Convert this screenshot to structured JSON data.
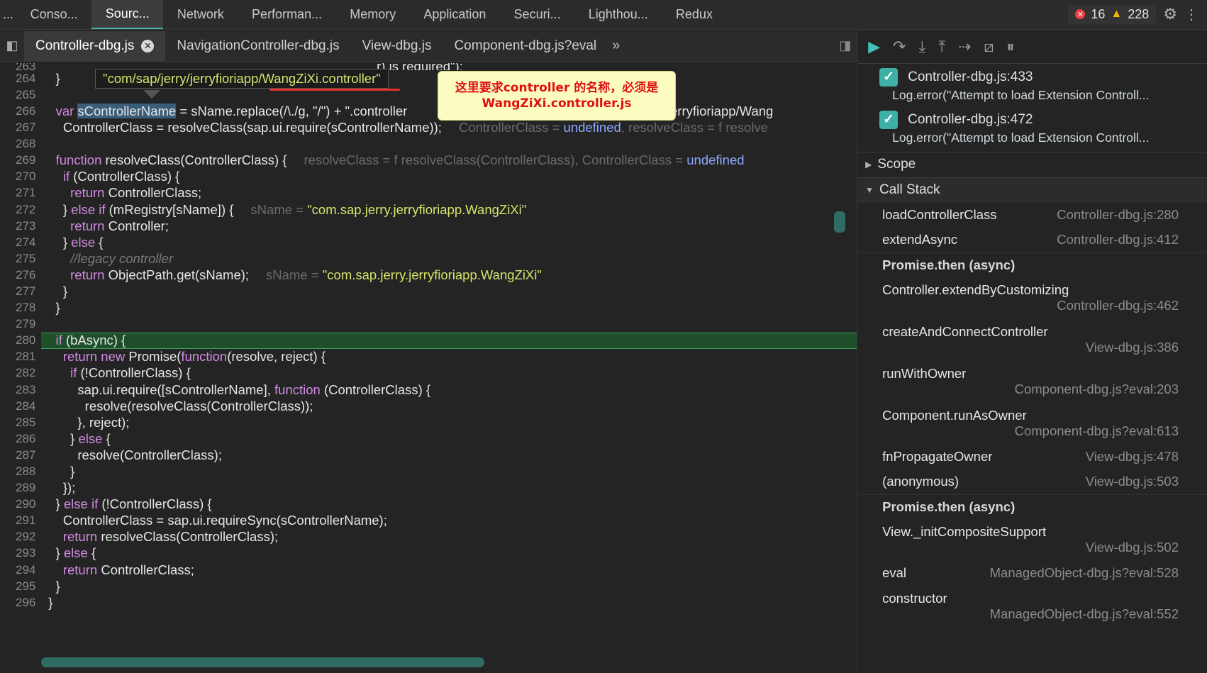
{
  "tabs": [
    "Conso...",
    "Sourc...",
    "Network",
    "Performan...",
    "Memory",
    "Application",
    "Securi...",
    "Lighthou...",
    "Redux"
  ],
  "active_tab": "Sourc...",
  "ellipsis": "...",
  "counts": {
    "errors": "16",
    "warnings": "228"
  },
  "files": {
    "tabs": [
      "Controller-dbg.js",
      "NavigationController-dbg.js",
      "View-dbg.js",
      "Component-dbg.js?eval"
    ],
    "more": "»"
  },
  "editor": {
    "hover_value": "\"com/sap/jerry/jerryfioriapp/WangZiXi.controller\"",
    "callout": {
      "line1": "这里要求controller 的名称，必须是",
      "line2": "WangZiXi.controller.js"
    },
    "partial_top": ".r) is required\");",
    "right_overflow": "erryfioriapp/Wang",
    "lines": [
      {
        "n": "264",
        "t": "    }"
      },
      {
        "n": "265",
        "t": ""
      },
      {
        "n": "266",
        "t": ""
      },
      {
        "n": "267",
        "t": ""
      },
      {
        "n": "268",
        "t": ""
      },
      {
        "n": "269",
        "t": ""
      },
      {
        "n": "270",
        "t": ""
      },
      {
        "n": "271",
        "t": ""
      },
      {
        "n": "272",
        "t": ""
      },
      {
        "n": "273",
        "t": ""
      },
      {
        "n": "274",
        "t": ""
      },
      {
        "n": "275",
        "t": ""
      },
      {
        "n": "276",
        "t": ""
      },
      {
        "n": "277",
        "t": "      }"
      },
      {
        "n": "278",
        "t": "    }"
      },
      {
        "n": "279",
        "t": ""
      },
      {
        "n": "280",
        "t": ""
      },
      {
        "n": "281",
        "t": ""
      },
      {
        "n": "282",
        "t": ""
      },
      {
        "n": "283",
        "t": ""
      },
      {
        "n": "284",
        "t": ""
      },
      {
        "n": "285",
        "t": "          }, reject);"
      },
      {
        "n": "286",
        "t": ""
      },
      {
        "n": "287",
        "t": "          resolve(ControllerClass);"
      },
      {
        "n": "288",
        "t": "        }"
      },
      {
        "n": "289",
        "t": "      });"
      },
      {
        "n": "290",
        "t": ""
      },
      {
        "n": "291",
        "t": "      ControllerClass = sap.ui.requireSync(sControllerName);"
      },
      {
        "n": "292",
        "t": ""
      },
      {
        "n": "293",
        "t": ""
      },
      {
        "n": "294",
        "t": ""
      },
      {
        "n": "295",
        "t": "    }"
      },
      {
        "n": "296",
        "t": "  }"
      }
    ],
    "l266": {
      "var": "var ",
      "name": "sControllerName",
      "rest": " = sName.replace(/\\./g, \"/\") + \".controller"
    },
    "l267": {
      "code": "      ControllerClass = resolveClass(sap.ui.require(sControllerName));",
      "hint_a": "ControllerClass = ",
      "hint_av": "undefined",
      "hint_b": ", resolveClass = ",
      "hint_bv": "f resolve"
    },
    "l269": {
      "kw": "function ",
      "code": "resolveClass(ControllerClass) {",
      "hint": "resolveClass = f resolveClass(ControllerClass), ControllerClass = ",
      "hint_v": "undefined"
    },
    "l270": {
      "kw": "      if ",
      "code": "(ControllerClass) {"
    },
    "l271": {
      "kw": "        return ",
      "code": "ControllerClass;"
    },
    "l272": {
      "pre": "      } ",
      "kw": "else if ",
      "code": "(mRegistry[sName]) {",
      "hint": "sName = ",
      "hint_v": "\"com.sap.jerry.jerryfioriapp.WangZiXi\""
    },
    "l273": {
      "kw": "        return ",
      "code": "Controller;"
    },
    "l274": {
      "pre": "      } ",
      "kw": "else ",
      "code": "{"
    },
    "l275": {
      "cm": "        //legacy controller"
    },
    "l276": {
      "kw": "        return ",
      "code": "ObjectPath.get(sName);",
      "hint": "sName = ",
      "hint_v": "\"com.sap.jerry.jerryfioriapp.WangZiXi\""
    },
    "l280": {
      "kw": "    if ",
      "code": "(bAsync) {"
    },
    "l281": {
      "kw": "      return new ",
      "code": "Promise(",
      "kw2": "function",
      "code2": "(resolve, reject) {"
    },
    "l282": {
      "kw": "        if ",
      "code": "(!ControllerClass) {"
    },
    "l283": {
      "code": "          sap.ui.require([sControllerName], ",
      "kw": "function ",
      "code2": "(ControllerClass) {"
    },
    "l284": {
      "code": "            resolve(resolveClass(ControllerClass));"
    },
    "l286": {
      "pre": "        } ",
      "kw": "else ",
      "code": "{"
    },
    "l290": {
      "pre": "    } ",
      "kw": "else if ",
      "code": "(!ControllerClass) {"
    },
    "l292": {
      "kw": "      return ",
      "code": "resolveClass(ControllerClass);"
    },
    "l293": {
      "pre": "    } ",
      "kw": "else ",
      "code": "{"
    },
    "l294": {
      "kw": "      return ",
      "code": "ControllerClass;"
    }
  },
  "breakpoints": [
    {
      "name": "Controller-dbg.js:433",
      "code": "Log.error(\"Attempt to load Extension Controll..."
    },
    {
      "name": "Controller-dbg.js:472",
      "code": "Log.error(\"Attempt to load Extension Controll..."
    }
  ],
  "sections": {
    "scope": "Scope",
    "callstack": "Call Stack"
  },
  "callstack": [
    {
      "type": "one",
      "name": "loadControllerClass",
      "loc": "Controller-dbg.js:280"
    },
    {
      "type": "one",
      "name": "extendAsync",
      "loc": "Controller-dbg.js:412"
    },
    {
      "type": "async",
      "name": "Promise.then (async)"
    },
    {
      "type": "two",
      "name": "Controller.extendByCustomizing",
      "loc": "Controller-dbg.js:462"
    },
    {
      "type": "two",
      "name": "createAndConnectController",
      "loc": "View-dbg.js:386"
    },
    {
      "type": "two",
      "name": "runWithOwner",
      "loc": "Component-dbg.js?eval:203"
    },
    {
      "type": "two",
      "name": "Component.runAsOwner",
      "loc": "Component-dbg.js?eval:613"
    },
    {
      "type": "one",
      "name": "fnPropagateOwner",
      "loc": "View-dbg.js:478"
    },
    {
      "type": "one",
      "name": "(anonymous)",
      "loc": "View-dbg.js:503"
    },
    {
      "type": "async",
      "name": "Promise.then (async)"
    },
    {
      "type": "two",
      "name": "View._initCompositeSupport",
      "loc": "View-dbg.js:502"
    },
    {
      "type": "one",
      "name": "eval",
      "loc": "ManagedObject-dbg.js?eval:528"
    },
    {
      "type": "two",
      "name": "constructor",
      "loc": "ManagedObject-dbg.js?eval:552"
    }
  ]
}
